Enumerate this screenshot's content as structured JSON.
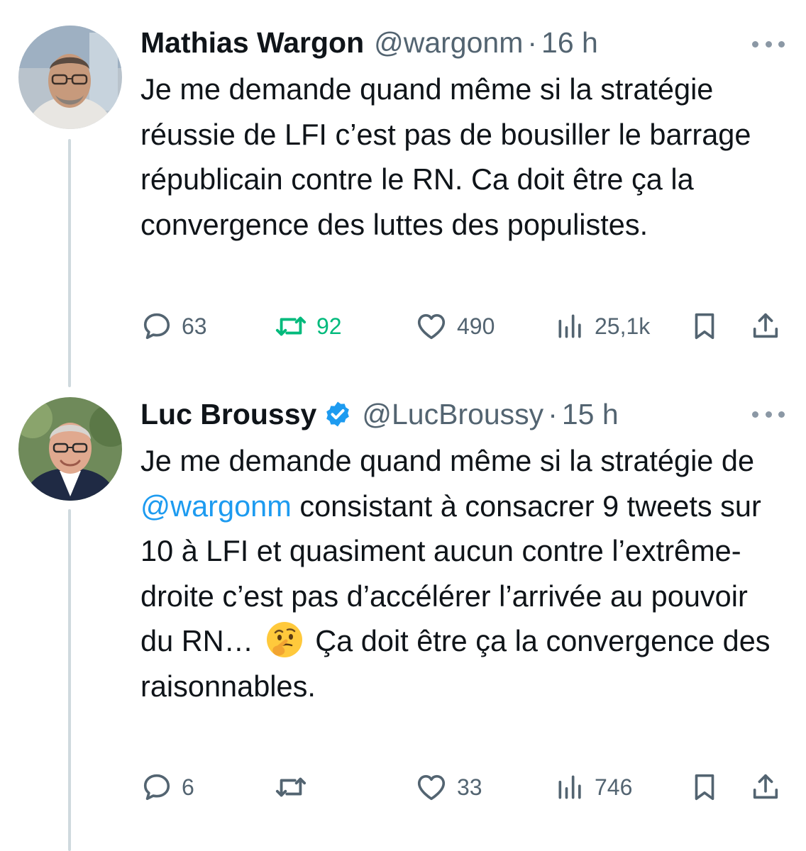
{
  "tweets": [
    {
      "author": {
        "name": "Mathias Wargon",
        "handle": "@wargonm",
        "verified": false
      },
      "time": "16 h",
      "text": "Je me demande quand même si la stratégie réussie de LFI c’est pas de bousiller le barrage républicain contre le RN. Ca doit être ça la convergence des luttes des populistes.",
      "stats": {
        "replies": "63",
        "reposts": "92",
        "likes": "490",
        "views": "25,1k"
      },
      "reposted_by_viewer": true
    },
    {
      "author": {
        "name": "Luc Broussy",
        "handle": "@LucBroussy",
        "verified": true
      },
      "time": "15 h",
      "text_parts": {
        "before_mention": "Je me demande quand même si la stratégie de",
        "mention": "@wargonm",
        "after_mention": "consistant à consacrer 9 tweets sur 10 à LFI et quasiment aucun contre l’extrême-droite c’est pas d’accélérer l’arrivée au pouvoir du RN…",
        "emoji": "thinking-face",
        "after_emoji": "Ça doit être ça la convergence des raisonnables."
      },
      "stats": {
        "replies": "6",
        "reposts": "",
        "likes": "33",
        "views": "746"
      },
      "reposted_by_viewer": false
    }
  ],
  "icons": {
    "reply": "reply-icon",
    "repost": "repost-icon",
    "like": "heart-icon",
    "views": "views-icon",
    "bookmark": "bookmark-icon",
    "share": "share-icon",
    "more": "more-icon",
    "verified": "verified-badge-icon"
  },
  "colors": {
    "text": "#0f1419",
    "secondary": "#536471",
    "accent": "#1d9bf0",
    "repost_active": "#00ba7c",
    "thread_line": "#cfd9de"
  }
}
